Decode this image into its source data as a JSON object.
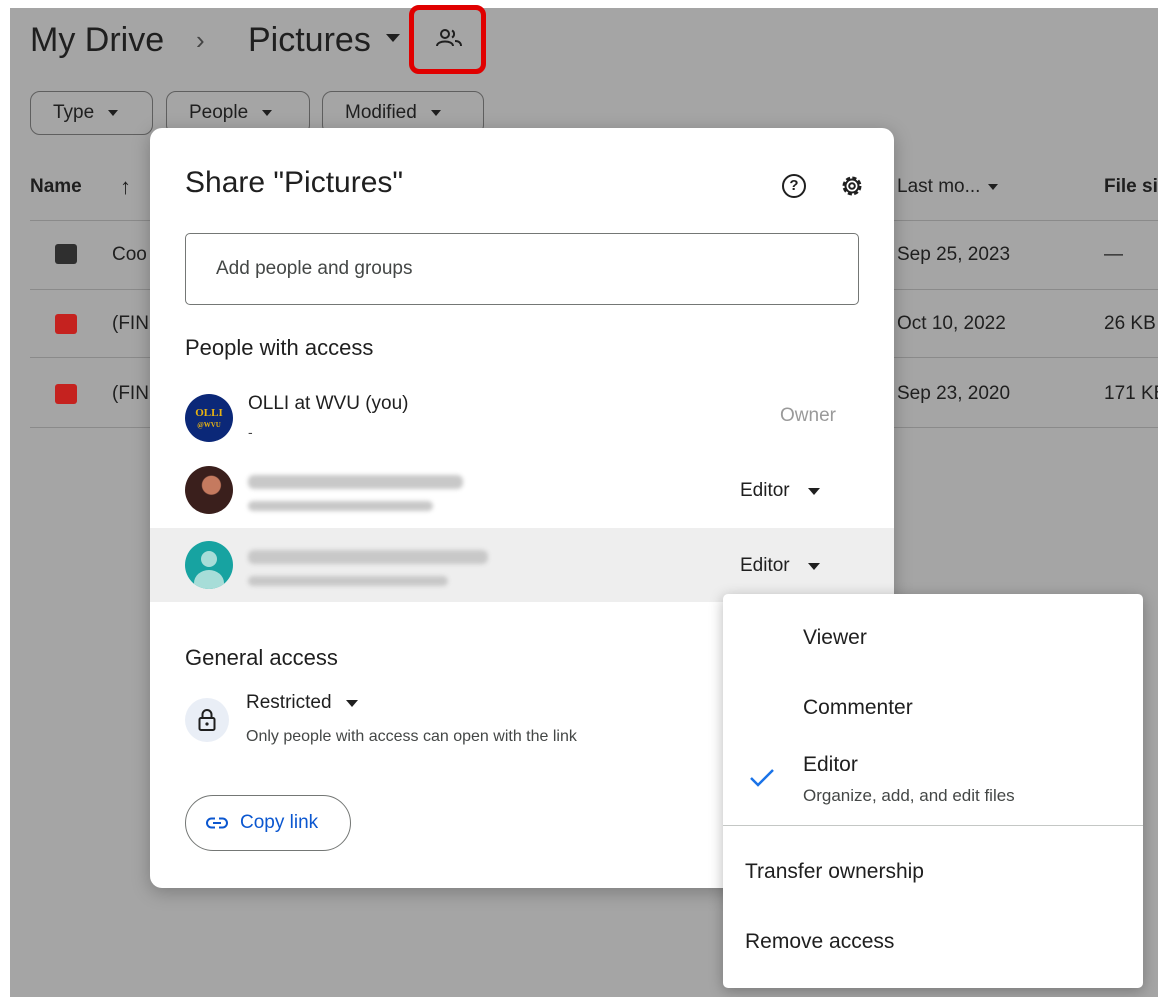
{
  "breadcrumb": {
    "root": "My Drive",
    "separator": "›",
    "current": "Pictures"
  },
  "filters": {
    "type": "Type",
    "people": "People",
    "modified": "Modified"
  },
  "table": {
    "headers": {
      "name": "Name",
      "sort_arrow": "↑",
      "last_modified": "Last mo...",
      "file_size": "File si"
    },
    "rows": [
      {
        "name": "Coo",
        "icon": "shared-folder-icon",
        "date": "Sep 25, 2023",
        "size": "—"
      },
      {
        "name": "(FIN",
        "icon": "image-file-icon",
        "date": "Oct 10, 2022",
        "size": "26 KB"
      },
      {
        "name": "(FIN",
        "icon": "image-file-icon",
        "date": "Sep 23, 2020",
        "size": "171 KB"
      }
    ]
  },
  "share_dialog": {
    "title": "Share \"Pictures\"",
    "help_glyph": "?",
    "add_placeholder": "Add people and groups",
    "people_heading": "People with access",
    "people": [
      {
        "avatar_text_1": "OLLI",
        "avatar_text_2": "@WVU",
        "name": "OLLI at WVU (you)",
        "sub": "-",
        "role": "Owner"
      },
      {
        "name": "",
        "sub": "",
        "role": "Editor"
      },
      {
        "name": "",
        "sub": "",
        "role": "Editor"
      }
    ],
    "general_heading": "General access",
    "general_value": "Restricted",
    "general_desc": "Only people with access can open with the link",
    "copy_link": "Copy link"
  },
  "role_menu": {
    "viewer": "Viewer",
    "commenter": "Commenter",
    "editor": "Editor",
    "editor_desc": "Organize, add, and edit files",
    "transfer": "Transfer ownership",
    "remove": "Remove access"
  },
  "colors": {
    "highlight_box": "#e00000",
    "link_blue": "#0b57d0",
    "check_blue": "#1a73e8",
    "overlay": "#a5a5a5"
  }
}
